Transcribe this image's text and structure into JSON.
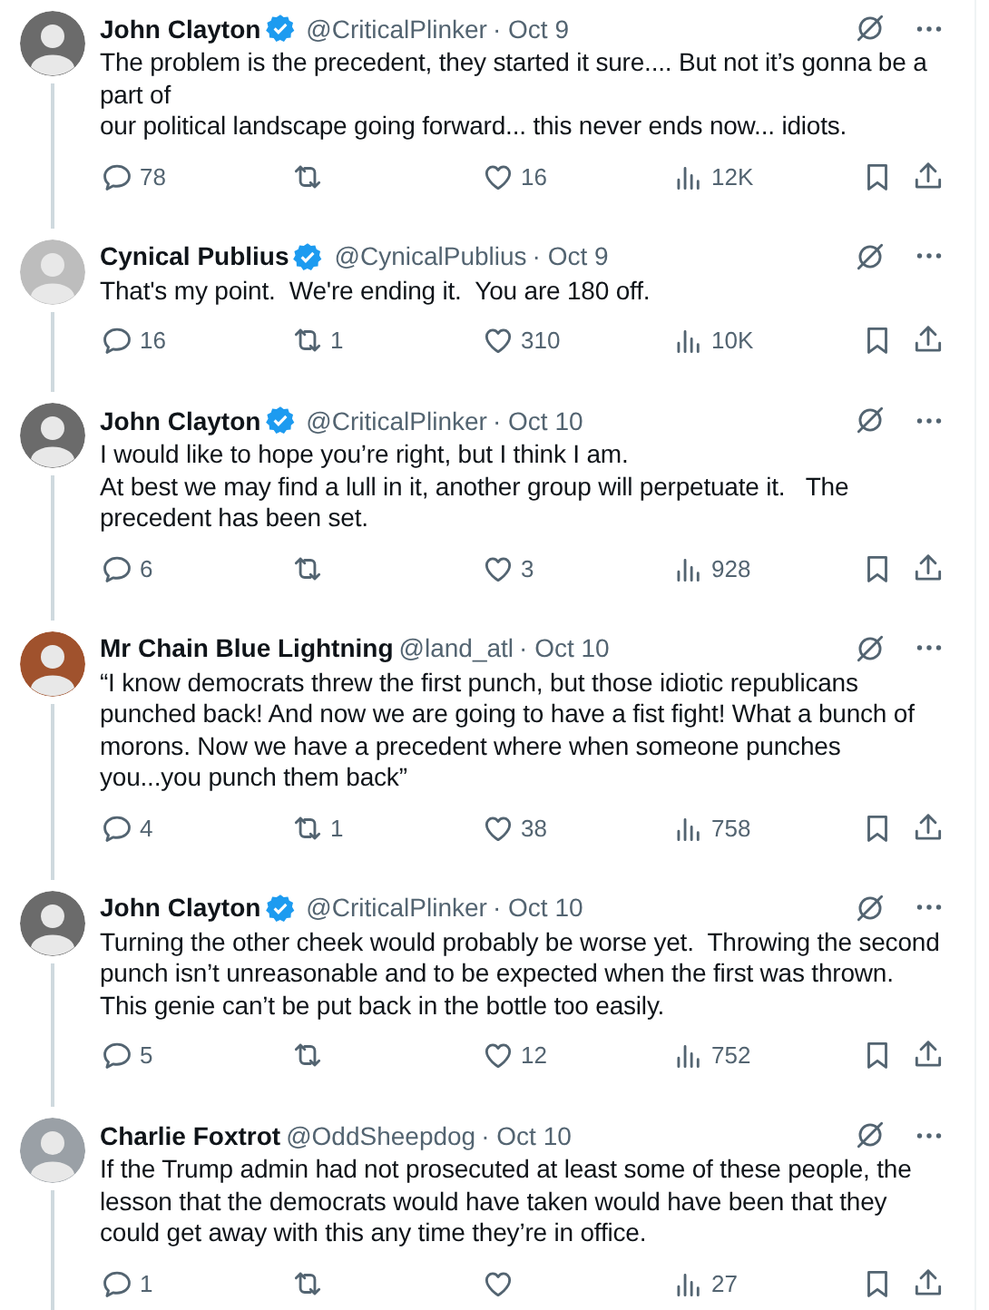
{
  "tweets": [
    {
      "name": "John Clayton",
      "verified": true,
      "handle": "@CriticalPlinker",
      "date": "· Oct 9",
      "text": "The problem is the precedent, they started it sure.... But not it’s gonna be a part of\nour political landscape going forward... this never ends now... idiots.",
      "replies": "78",
      "likes": "16",
      "views": "12K"
    },
    {
      "name": "Cynical Publius",
      "verified": true,
      "handle": "@CynicalPublius",
      "date": "· Oct 9",
      "text": "That's my point.  We're ending it.  You are 180 off.",
      "replies": "16",
      "retweets": "1",
      "likes": "310",
      "views": "10K"
    },
    {
      "name": "John Clayton",
      "verified": true,
      "handle": "@CriticalPlinker",
      "date": "· Oct 10",
      "text": "I would like to hope you’re right, but I think I am.\nAt best we may find a lull in it, another group will perpetuate it.   The precedent has been set.",
      "replies": "6",
      "likes": "3",
      "views": "928"
    },
    {
      "name": "Mr Chain Blue Lightning",
      "verified": false,
      "handle": "@land_atl",
      "date": "· Oct 10",
      "text": "“I know democrats threw the first punch, but those idiotic republicans punched back! And now we are going to have a fist fight! What a bunch of morons. Now we have a precedent where when someone punches you...you punch them back”",
      "replies": "4",
      "retweets": "1",
      "likes": "38",
      "views": "758"
    },
    {
      "name": "John Clayton",
      "verified": true,
      "handle": "@CriticalPlinker",
      "date": "· Oct 10",
      "text": "Turning the other cheek would probably be worse yet.  Throwing the second punch isn’t unreasonable and to be expected when the first was thrown.  This genie can’t be put back in the bottle too easily.",
      "replies": "5",
      "likes": "12",
      "views": "752"
    },
    {
      "name": "Charlie Foxtrot",
      "verified": false,
      "handle": "@OddSheepdog",
      "date": "· Oct 10",
      "text": "If the Trump admin had not prosecuted at least some of these people, the lesson that the democrats would have taken would have been that they could get away with this any time they’re in office.",
      "replies": "1",
      "views": "27"
    }
  ]
}
